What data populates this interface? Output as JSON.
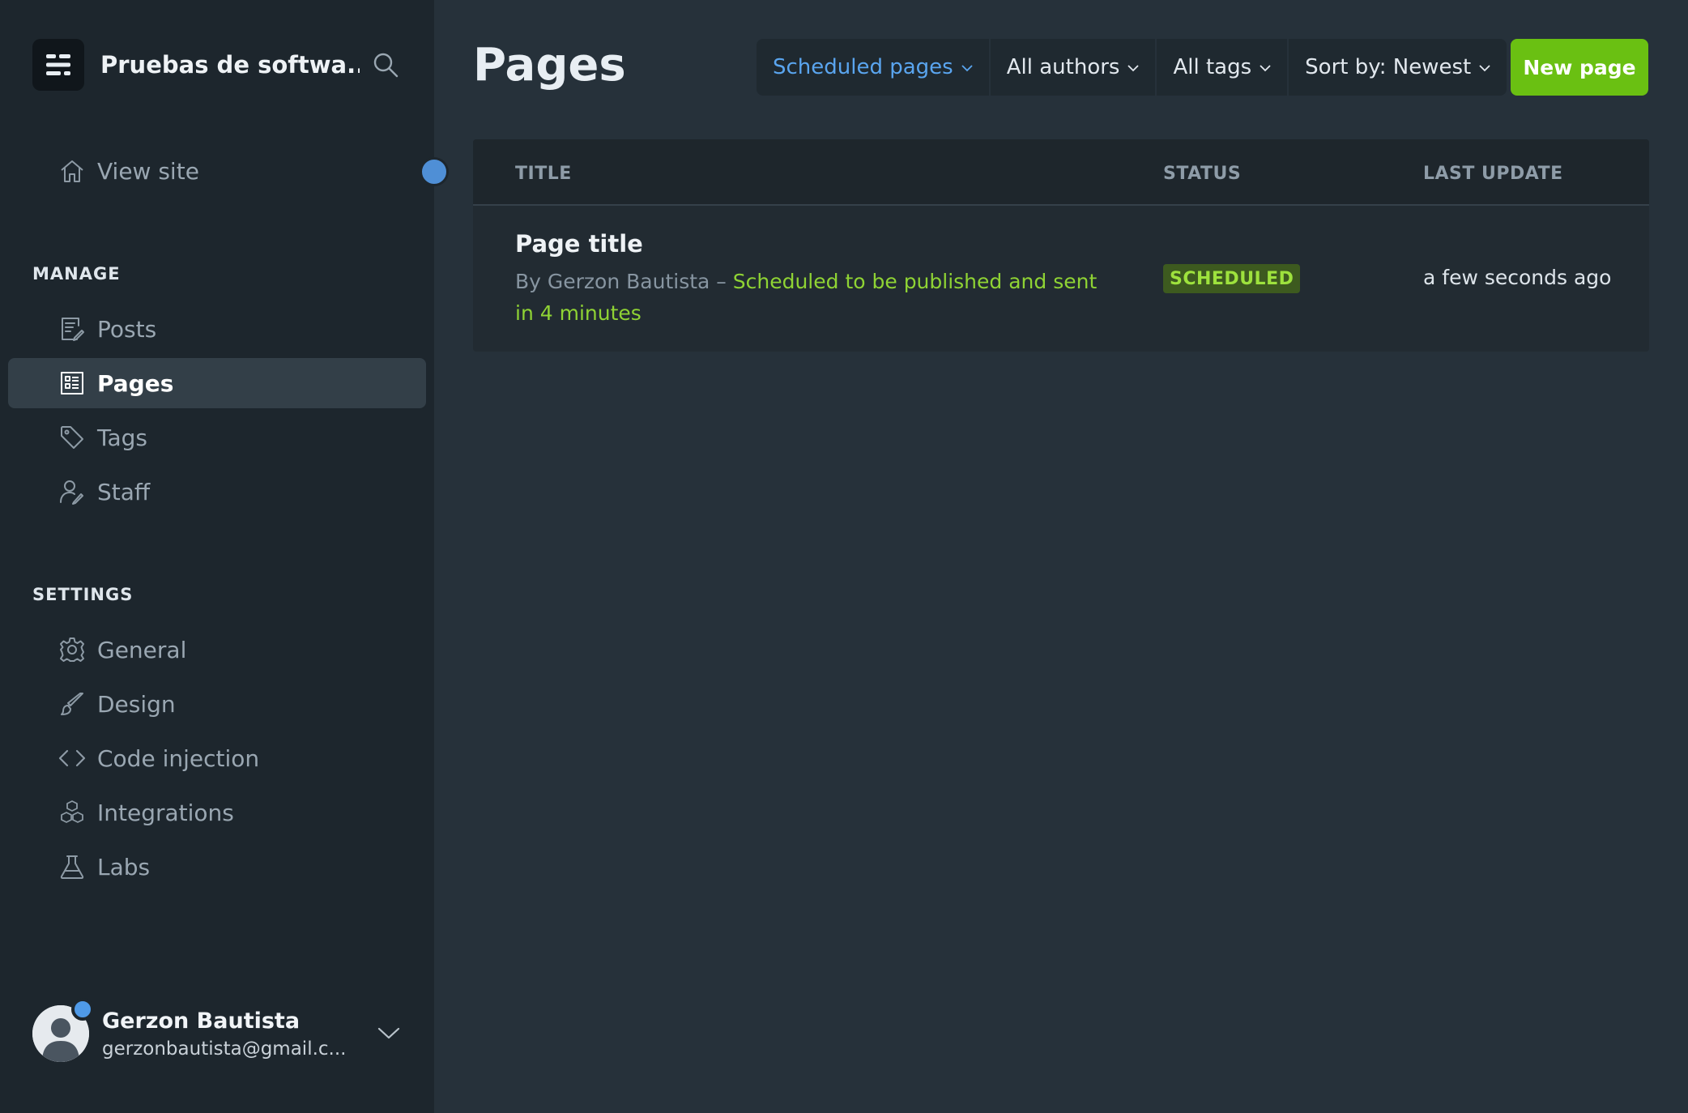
{
  "sidebar": {
    "site_name": "Pruebas de softwa...",
    "view_site": "View site",
    "manage_label": "MANAGE",
    "settings_label": "SETTINGS",
    "manage_items": [
      {
        "label": "Posts",
        "icon": "posts-icon"
      },
      {
        "label": "Pages",
        "icon": "pages-icon"
      },
      {
        "label": "Tags",
        "icon": "tag-icon"
      },
      {
        "label": "Staff",
        "icon": "staff-icon"
      }
    ],
    "settings_items": [
      {
        "label": "General",
        "icon": "gear-icon"
      },
      {
        "label": "Design",
        "icon": "brush-icon"
      },
      {
        "label": "Code injection",
        "icon": "code-icon"
      },
      {
        "label": "Integrations",
        "icon": "cubes-icon"
      },
      {
        "label": "Labs",
        "icon": "flask-icon"
      }
    ],
    "user": {
      "name": "Gerzon Bautista",
      "email": "gerzonbautista@gmail.c..."
    }
  },
  "header": {
    "title": "Pages",
    "filters": [
      {
        "label": "Scheduled pages",
        "active": true
      },
      {
        "label": "All authors"
      },
      {
        "label": "All tags"
      },
      {
        "label": "Sort by: Newest"
      }
    ],
    "new_button": "New page"
  },
  "table": {
    "columns": [
      "TITLE",
      "STATUS",
      "LAST UPDATE"
    ],
    "rows": [
      {
        "title": "Page title",
        "byline": "By Gerzon Bautista –",
        "schedule": "Scheduled to be published and sent in 4 minutes",
        "status": "SCHEDULED",
        "updated": "a few seconds ago"
      }
    ]
  },
  "colors": {
    "accent_blue": "#5aa5ef",
    "primary_green": "#6ac012",
    "scheduled_green": "#8fd334",
    "sidebar_bg": "#1d262d",
    "main_bg": "#26313a"
  }
}
